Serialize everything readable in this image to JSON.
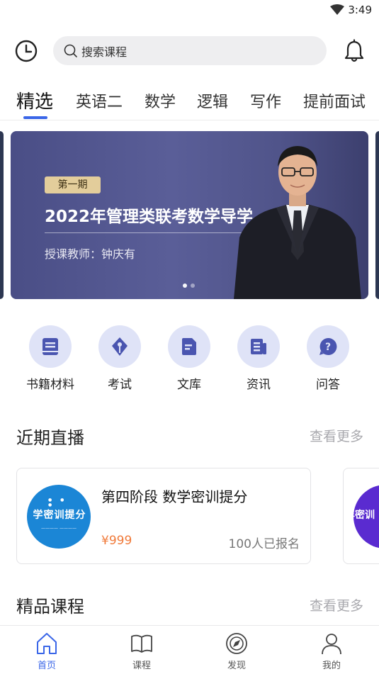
{
  "status_bar": {
    "time": "3:49",
    "wifi_icon": "wifi-icon"
  },
  "header": {
    "history_icon": "clock-icon",
    "search_placeholder": "搜索课程",
    "notification_icon": "bell-icon"
  },
  "tabs": [
    {
      "label": "精选",
      "active": true
    },
    {
      "label": "英语二"
    },
    {
      "label": "数学"
    },
    {
      "label": "逻辑"
    },
    {
      "label": "写作"
    },
    {
      "label": "提前面试"
    }
  ],
  "banner": {
    "tag": "第一期",
    "title": "2022年管理类联考数学导学",
    "teacher": "授课教师：钟庆有",
    "slide_count": 2,
    "active_slide": 1
  },
  "quick_links": [
    {
      "label": "书籍材料",
      "icon": "book-icon"
    },
    {
      "label": "考试",
      "icon": "pen-nib-icon"
    },
    {
      "label": "文库",
      "icon": "document-icon"
    },
    {
      "label": "资讯",
      "icon": "news-icon"
    },
    {
      "label": "问答",
      "icon": "question-icon"
    }
  ],
  "recent_live": {
    "title": "近期直播",
    "more": "查看更多",
    "cards": [
      {
        "thumb_text": "学密训提分",
        "title": "第四阶段 数学密训提分",
        "price": "¥999",
        "enrolled": "100人已报名"
      }
    ],
    "peek_thumb_text": "年密训"
  },
  "premium_courses": {
    "title": "精品课程",
    "more": "查看更多"
  },
  "bottom_nav": [
    {
      "label": "首页",
      "icon": "home-icon",
      "active": true
    },
    {
      "label": "课程",
      "icon": "open-book-icon"
    },
    {
      "label": "发现",
      "icon": "compass-icon"
    },
    {
      "label": "我的",
      "icon": "user-icon"
    }
  ],
  "colors": {
    "accent": "#3a66e8",
    "price": "#f07a3a",
    "banner_tag": "#e3cd9b",
    "quick_icon_bg": "#dfe3f7",
    "quick_icon_fg": "#4a55b0"
  }
}
